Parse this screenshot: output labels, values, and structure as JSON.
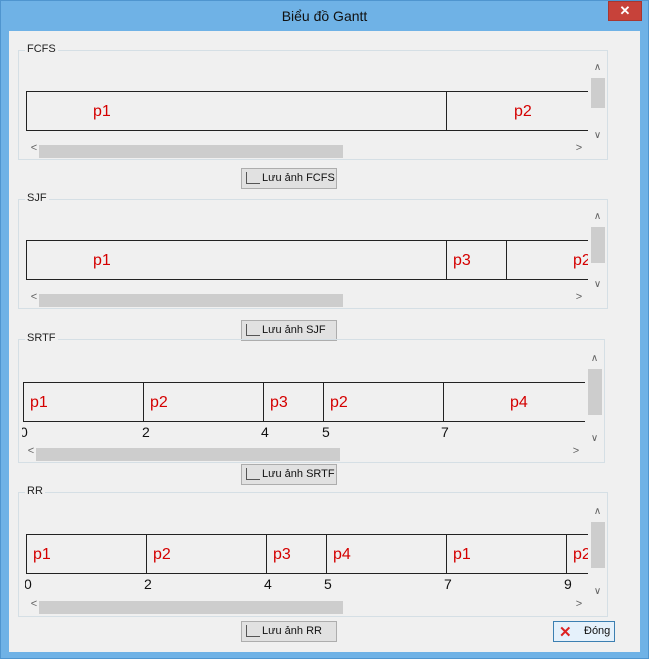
{
  "window": {
    "title": "Biểu đồ Gantt",
    "close_glyph": "✕",
    "close_icon": "close-icon"
  },
  "charts": [
    {
      "id": "fcfs",
      "label": "FCFS",
      "button_label": "Lưu ảnh FCFS",
      "segments": [
        {
          "name": "p1"
        },
        {
          "name": "p2"
        }
      ],
      "ticks": []
    },
    {
      "id": "sjf",
      "label": "SJF",
      "button_label": "Lưu ảnh SJF",
      "segments": [
        {
          "name": "p1"
        },
        {
          "name": "p3"
        },
        {
          "name": "p2"
        }
      ],
      "ticks": []
    },
    {
      "id": "srtf",
      "label": "SRTF",
      "button_label": "Lưu ảnh SRTF",
      "segments": [
        {
          "name": "p1"
        },
        {
          "name": "p2"
        },
        {
          "name": "p3"
        },
        {
          "name": "p2"
        },
        {
          "name": "p4"
        }
      ],
      "ticks": [
        "0",
        "2",
        "4",
        "5",
        "7"
      ]
    },
    {
      "id": "rr",
      "label": "RR",
      "button_label": "Lưu ảnh RR",
      "segments": [
        {
          "name": "p1"
        },
        {
          "name": "p2"
        },
        {
          "name": "p3"
        },
        {
          "name": "p4"
        },
        {
          "name": "p1"
        },
        {
          "name": "p2"
        }
      ],
      "ticks": [
        "0",
        "2",
        "4",
        "5",
        "7",
        "9"
      ]
    }
  ],
  "footer": {
    "close_label": "Đóng"
  },
  "colors": {
    "process_label": "#d40000",
    "titlebar": "#6fb2e6",
    "client_bg": "#f0f0f0"
  }
}
